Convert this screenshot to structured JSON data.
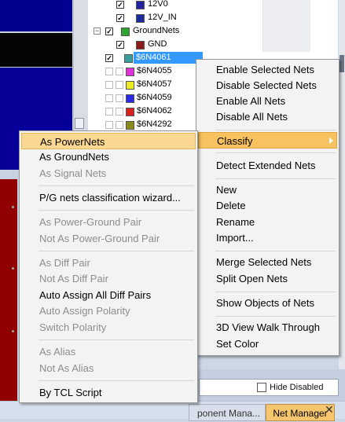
{
  "tree": {
    "rows": [
      {
        "label": "12V0",
        "checked": true,
        "color": "#2323a0"
      },
      {
        "label": "12V_IN",
        "checked": true,
        "color": "#1c2c9c"
      },
      {
        "label": "GroundNets",
        "checked": true,
        "color": "#2fa32f",
        "group": true
      },
      {
        "label": "GND",
        "checked": true,
        "color": "#8b1a1a"
      },
      {
        "label": "$6N4061",
        "checked": true,
        "color": "#3a9e9e",
        "selected": true
      },
      {
        "label": "$6N4055",
        "checked": false,
        "color": "#e12fd9"
      },
      {
        "label": "$6N4057",
        "checked": false,
        "color": "#ecec24"
      },
      {
        "label": "$6N4059",
        "checked": false,
        "color": "#2a2ae6"
      },
      {
        "label": "$6N4062",
        "checked": false,
        "color": "#d82020"
      },
      {
        "label": "$6N4292",
        "checked": false,
        "color": "#8a8a1a"
      }
    ]
  },
  "footer": {
    "hide_disabled": "Hide Disabled",
    "tab_component": "ponent Mana...",
    "tab_net": "Net Manager",
    "close": "✕"
  },
  "main_menu": {
    "items": [
      {
        "label": "Enable Selected Nets"
      },
      {
        "label": "Disable Selected Nets"
      },
      {
        "label": "Enable All Nets"
      },
      {
        "label": "Disable All Nets"
      },
      {
        "label": "Classify",
        "submenu": true
      },
      {
        "label": "Detect Extended Nets"
      },
      {
        "label": "New"
      },
      {
        "label": "Delete"
      },
      {
        "label": "Rename"
      },
      {
        "label": "Import..."
      },
      {
        "label": "Merge Selected Nets"
      },
      {
        "label": "Split Open Nets"
      },
      {
        "label": "Show Objects of Nets"
      },
      {
        "label": "3D View Walk Through"
      },
      {
        "label": "Set Color"
      }
    ]
  },
  "classify_menu": {
    "items": [
      {
        "label": "As PowerNets",
        "highlighted": true
      },
      {
        "label": "As GroundNets"
      },
      {
        "label": "As Signal Nets",
        "disabled": true
      },
      {
        "label": "P/G nets classification wizard..."
      },
      {
        "label": "As Power-Ground Pair",
        "disabled": true
      },
      {
        "label": "Not As Power-Ground Pair",
        "disabled": true
      },
      {
        "label": "As Diff Pair",
        "disabled": true
      },
      {
        "label": "Not As Diff Pair",
        "disabled": true
      },
      {
        "label": "Auto Assign All Diff Pairs"
      },
      {
        "label": "Auto Assign Polarity",
        "disabled": true
      },
      {
        "label": "Switch Polarity",
        "disabled": true
      },
      {
        "label": "As Alias",
        "disabled": true
      },
      {
        "label": "Not As Alias",
        "disabled": true
      },
      {
        "label": "By TCL Script"
      }
    ]
  }
}
